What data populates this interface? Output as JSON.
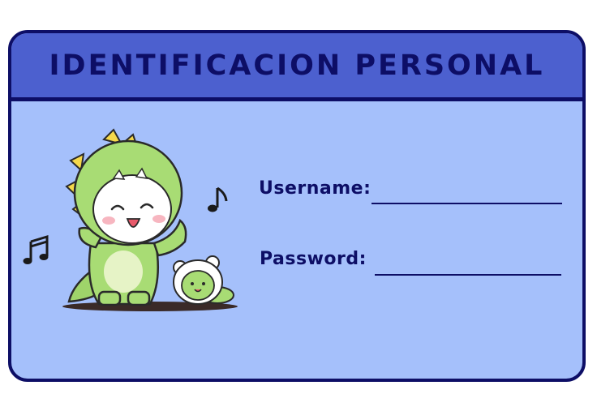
{
  "card": {
    "title": "IDENTIFICACION PERSONAL",
    "colors": {
      "header": "#4c60cf",
      "body": "#a5c0fb",
      "outline": "#0d0e66"
    }
  },
  "fields": {
    "username_label": "Username:",
    "username_value": "",
    "password_label": "Password:",
    "password_value": ""
  },
  "illustration": {
    "icons": [
      "dinosaur-costume-character-icon",
      "small-dino-hood-character-icon",
      "music-note-icon",
      "double-music-note-icon"
    ]
  }
}
